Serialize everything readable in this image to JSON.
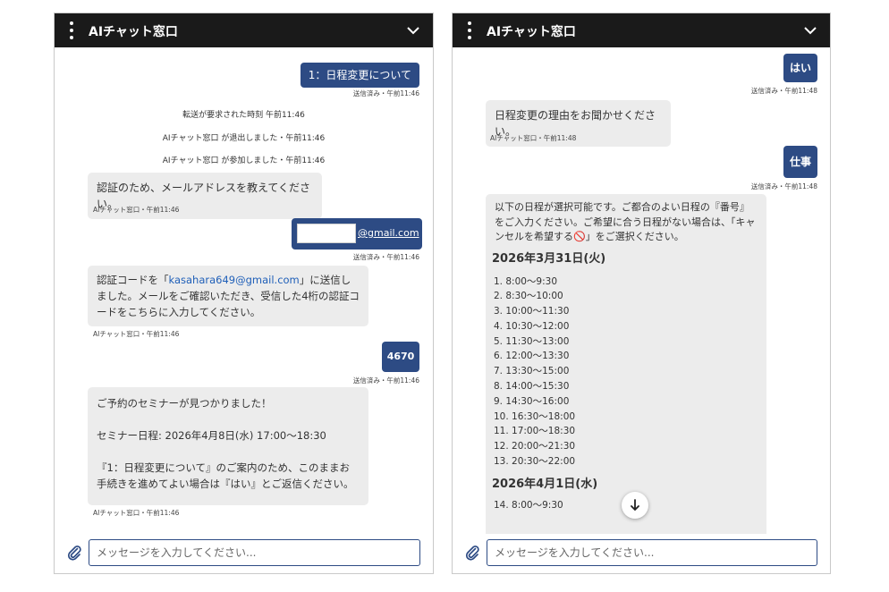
{
  "header": {
    "title": "AIチャット窓口"
  },
  "input": {
    "placeholder": "メッセージを入力してください..."
  },
  "left": {
    "msg1": {
      "text": "1：日程変更について",
      "meta": "送信済み・午前11:46"
    },
    "sys1": "転送が要求された時刻 午前11:46",
    "sys2": "AIチャット窓口 が退出しました・午前11:46",
    "sys3": "AIチャット窓口 が参加しました・午前11:46",
    "bot1": {
      "text": "認証のため、メールアドレスを教えてください。",
      "meta": "AIチャット窓口・午前11:46"
    },
    "email": {
      "domain": "@gmail.com",
      "meta": "送信済み・午前11:46"
    },
    "bot2": {
      "pre": "認証コードを「",
      "email": "kasahara649@gmail.com",
      "post": "」に送信しました。メールをご確認いただき、受信した4桁の認証コードをこちらに入力してください。",
      "meta": "AIチャット窓口・午前11:46"
    },
    "code": {
      "text": "4670",
      "meta": "送信済み・午前11:46"
    },
    "bot3": {
      "line1": "ご予約のセミナーが見つかりました！",
      "line2": "セミナー日程: 2026年4月8日(水) 17:00〜18:30",
      "line3": "『1：日程変更について』のご案内のため、このままお手続きを進めてよい場合は『はい』とご返信ください。",
      "meta": "AIチャット窓口・午前11:46"
    }
  },
  "right": {
    "yes": {
      "text": "はい",
      "meta": "送信済み・午前11:48"
    },
    "bot1": {
      "text": "日程変更の理由をお聞かせください。",
      "meta": "AIチャット窓口・午前11:48"
    },
    "work": {
      "text": "仕事",
      "meta": "送信済み・午前11:48"
    },
    "bot2": {
      "intro": "以下の日程が選択可能です。ご都合のよい日程の『番号』をご入力ください。ご希望に合う日程がない場合は、「キャンセルを希望する🚫」をご選択ください。",
      "date1": "2026年3月31日(火)",
      "slots": [
        "1. 8:00〜9:30",
        "2. 8:30〜10:00",
        "3. 10:00〜11:30",
        "4. 10:30〜12:00",
        "5. 11:30〜13:00",
        "6. 12:00〜13:30",
        "7. 13:30〜15:00",
        "8. 14:00〜15:30",
        "9. 14:30〜16:00",
        "10. 16:30〜18:00",
        "11. 17:00〜18:30",
        "12. 20:00〜21:30",
        "13. 20:30〜22:00"
      ],
      "date2": "2026年4月1日(水)",
      "slot14": "14. 8:00〜9:30"
    }
  },
  "icons": {
    "menu": "kebab-menu-icon",
    "collapse": "chevron-down-icon",
    "attach": "paperclip-icon",
    "scroll": "arrow-down-icon"
  },
  "colors": {
    "header": "#1a1a1a",
    "outgoing": "#2d4b84",
    "incoming": "#ececec",
    "link": "#1f5fb8"
  }
}
